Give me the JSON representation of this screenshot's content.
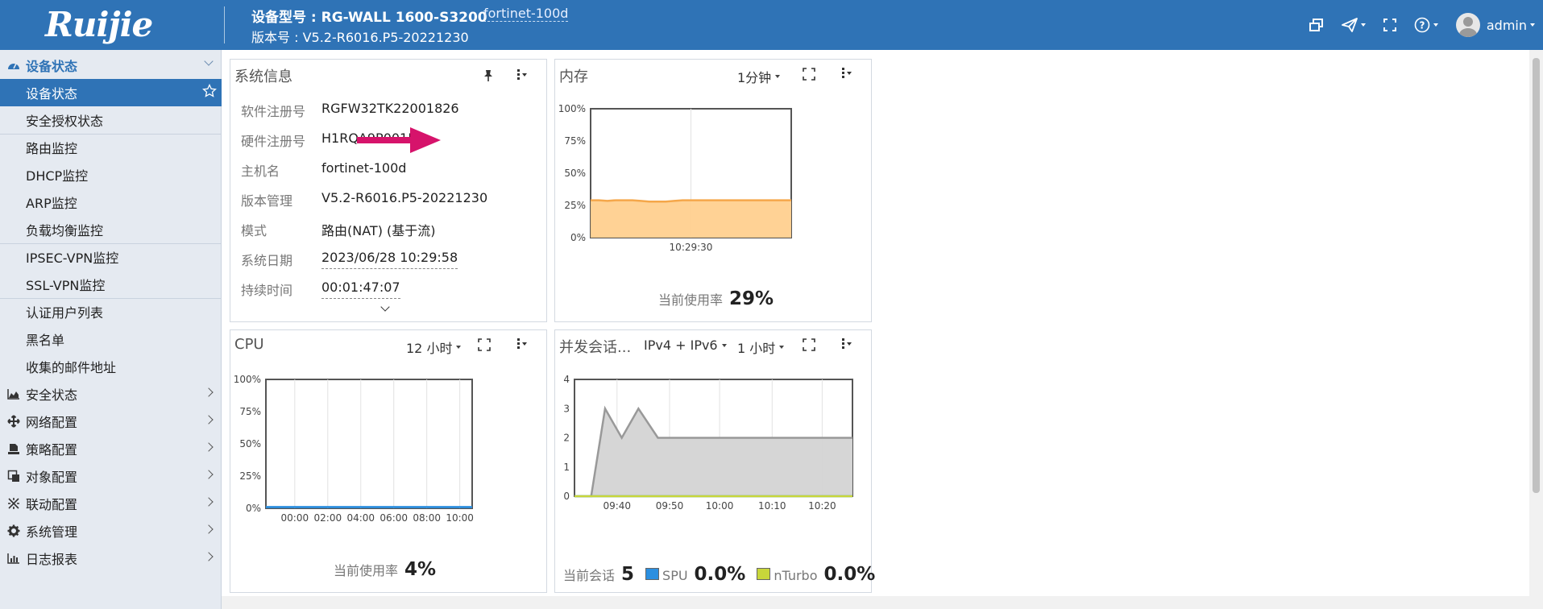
{
  "header": {
    "logo": "Ruijie",
    "device_model": "设备型号 : RG-WALL 1600-S3200",
    "hostname": "fortinet-100d",
    "version": "版本号 : V5.2-R6016.P5-20221230",
    "user": "admin",
    "icons": [
      "window-restore-icon",
      "send-icon",
      "fullscreen-icon",
      "help-icon",
      "user-avatar-icon"
    ]
  },
  "sidebar": {
    "groups": [
      {
        "label": "设备状态",
        "icon": "dashboard-icon",
        "open": true,
        "items": [
          "设备状态",
          "安全授权状态",
          "路由监控",
          "DHCP监控",
          "ARP监控",
          "负载均衡监控",
          "IPSEC-VPN监控",
          "SSL-VPN监控",
          "认证用户列表",
          "黑名单",
          "收集的邮件地址"
        ],
        "selected": "设备状态"
      },
      {
        "label": "安全状态",
        "icon": "area-chart-icon"
      },
      {
        "label": "网络配置",
        "icon": "arrows-icon"
      },
      {
        "label": "策略配置",
        "icon": "policy-icon"
      },
      {
        "label": "对象配置",
        "icon": "object-icon"
      },
      {
        "label": "联动配置",
        "icon": "linkage-icon"
      },
      {
        "label": "系统管理",
        "icon": "gear-icon"
      },
      {
        "label": "日志报表",
        "icon": "bar-chart-icon"
      }
    ]
  },
  "sysinfo": {
    "title": "系统信息",
    "rows": [
      {
        "k": "软件注册号",
        "v": "RGFW32TK22001826"
      },
      {
        "k": "硬件注册号",
        "v": "H1RQA9P0015"
      },
      {
        "k": "主机名",
        "v": "fortinet-100d"
      },
      {
        "k": "版本管理",
        "v": "V5.2-R6016.P5-20221230"
      },
      {
        "k": "模式",
        "v": "路由(NAT) (基于流)"
      },
      {
        "k": "系统日期",
        "v": "2023/06/28 10:29:58"
      },
      {
        "k": "持续时间",
        "v": "00:01:47:07"
      }
    ]
  },
  "memory": {
    "title": "内存",
    "interval": "1分钟",
    "current_label": "当前使用率",
    "current_value": "29%",
    "chart_data": {
      "type": "area",
      "yticks": [
        "100%",
        "75%",
        "50%",
        "25%",
        "0%"
      ],
      "xticks": [
        "10:29:30"
      ],
      "ylim": [
        0,
        100
      ],
      "values": [
        29,
        29,
        28.5,
        29,
        29,
        29,
        28.5,
        28,
        28,
        28,
        28.5,
        29,
        29,
        29,
        29,
        29,
        29,
        29,
        29,
        29,
        29,
        29,
        29,
        29,
        29
      ],
      "color": "#f5a74a"
    }
  },
  "cpu": {
    "title": "CPU",
    "interval": "12 小时",
    "current_label": "当前使用率",
    "current_value": "4%",
    "chart_data": {
      "type": "area",
      "yticks": [
        "100%",
        "75%",
        "50%",
        "25%",
        "0%"
      ],
      "xticks": [
        "00:00",
        "02:00",
        "04:00",
        "06:00",
        "08:00",
        "10:00"
      ],
      "ylim": [
        0,
        100
      ],
      "values": [
        1,
        1,
        1,
        1,
        1,
        1,
        1,
        1,
        1,
        1,
        1,
        1
      ],
      "color": "#2b8fe0"
    }
  },
  "sessions": {
    "title": "并发会话...",
    "protocol": "IPv4 + IPv6",
    "interval": "1 小时",
    "current_label": "当前会话",
    "current_value": "5",
    "spu_label": "SPU",
    "spu_value": "0.0%",
    "nturbo_label": "nTurbo",
    "nturbo_value": "0.0%",
    "chart_data": {
      "type": "area",
      "yticks": [
        "4",
        "3",
        "2",
        "1",
        "0"
      ],
      "xticks": [
        "09:40",
        "09:50",
        "10:00",
        "10:10",
        "10:20"
      ],
      "ylim": [
        0,
        4
      ],
      "series": [
        {
          "name": "会话",
          "color": "#999999",
          "x": [
            0,
            0.06,
            0.11,
            0.17,
            0.23,
            0.3,
            1
          ],
          "values": [
            0,
            0,
            3,
            2,
            3,
            2,
            2
          ]
        },
        {
          "name": "SPU",
          "color": "#2b8fe0",
          "values": [
            0,
            0
          ]
        },
        {
          "name": "nTurbo",
          "color": "#c8d63a",
          "values": [
            0,
            0
          ]
        }
      ]
    }
  }
}
